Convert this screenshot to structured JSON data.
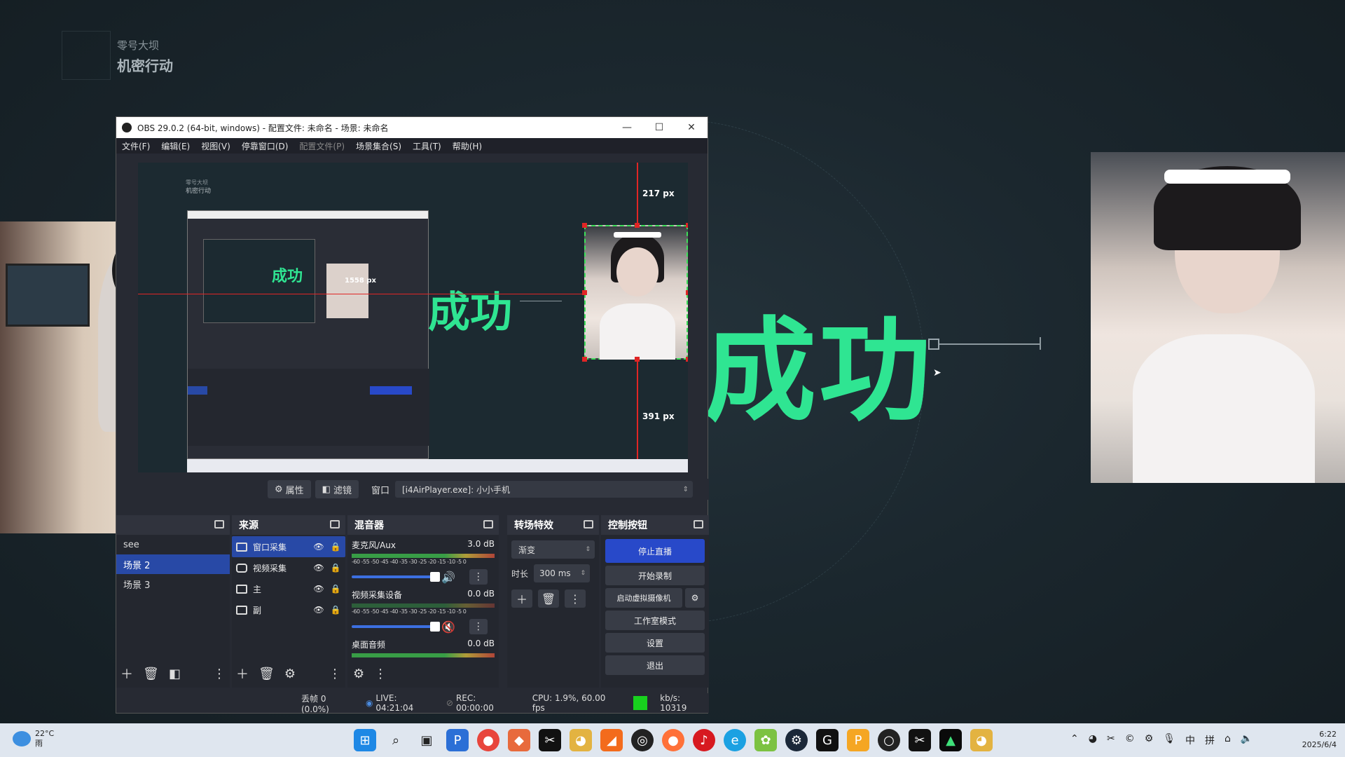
{
  "desktop": {
    "brand_sub": "零号大坝",
    "brand_main": "机密行动",
    "big_text": "成功"
  },
  "obs": {
    "title": "OBS 29.0.2 (64-bit, windows) - 配置文件: 未命名 - 场景: 未命名",
    "window_controls": [
      "—",
      "☐",
      "✕"
    ],
    "menu": [
      "文件(F)",
      "编辑(E)",
      "视图(V)",
      "停靠窗口(D)",
      "配置文件(P)",
      "场景集合(S)",
      "工具(T)",
      "帮助(H)"
    ],
    "preview": {
      "brand_sub": "零号大坝",
      "brand_main": "机密行动",
      "big_text": "成功",
      "top_distance": "217 px",
      "bottom_distance": "391 px",
      "inner_distance": "1558 px"
    },
    "source_toolbar": {
      "properties": "属性",
      "filters": "滤镜",
      "window_label": "窗口",
      "window_value": "[i4AirPlayer.exe]: 小小手机"
    },
    "scenes": {
      "items": [
        "see",
        "场景 2",
        "场景 3"
      ],
      "selected_index": 1
    },
    "sources": {
      "title": "来源",
      "items": [
        {
          "name": "窗口采集",
          "icon": "window-icon",
          "selected": true
        },
        {
          "name": "视频采集",
          "icon": "camera-icon",
          "selected": false
        },
        {
          "name": "主",
          "icon": "monitor-icon",
          "selected": false
        },
        {
          "name": "副",
          "icon": "monitor-icon",
          "selected": false
        }
      ]
    },
    "mixer": {
      "title": "混音器",
      "scale": "-60 -55 -50 -45 -40 -35 -30 -25 -20 -15 -10 -5 0",
      "channels": [
        {
          "name": "麦克风/Aux",
          "db": "3.0 dB",
          "muted": false,
          "level": 0.85
        },
        {
          "name": "视频采集设备",
          "db": "0.0 dB",
          "muted": true,
          "level": 0.85
        },
        {
          "name": "桌面音频",
          "db": "0.0 dB",
          "muted": false,
          "level": 0.85
        }
      ]
    },
    "transitions": {
      "title": "转场特效",
      "selected": "渐变",
      "duration_label": "时长",
      "duration_value": "300 ms"
    },
    "controls": {
      "title": "控制按钮",
      "buttons": [
        "停止直播",
        "开始录制",
        "启动虚拟摄像机",
        "工作室模式",
        "设置",
        "退出"
      ]
    },
    "status": {
      "dropped": "丢帧 0 (0.0%)",
      "live": "LIVE: 04:21:04",
      "rec": "REC: 00:00:00",
      "cpu": "CPU: 1.9%, 60.00 fps",
      "kbs": "kb/s: 10319"
    }
  },
  "taskbar": {
    "temperature": "22°C",
    "weather": "雨",
    "ime1": "中",
    "ime2": "拼",
    "time": "6:22",
    "date": "2025/6/4"
  },
  "colors": {
    "accent_green": "#2fe592",
    "obs_blue": "#2849a6",
    "live_green": "#18d11e"
  }
}
